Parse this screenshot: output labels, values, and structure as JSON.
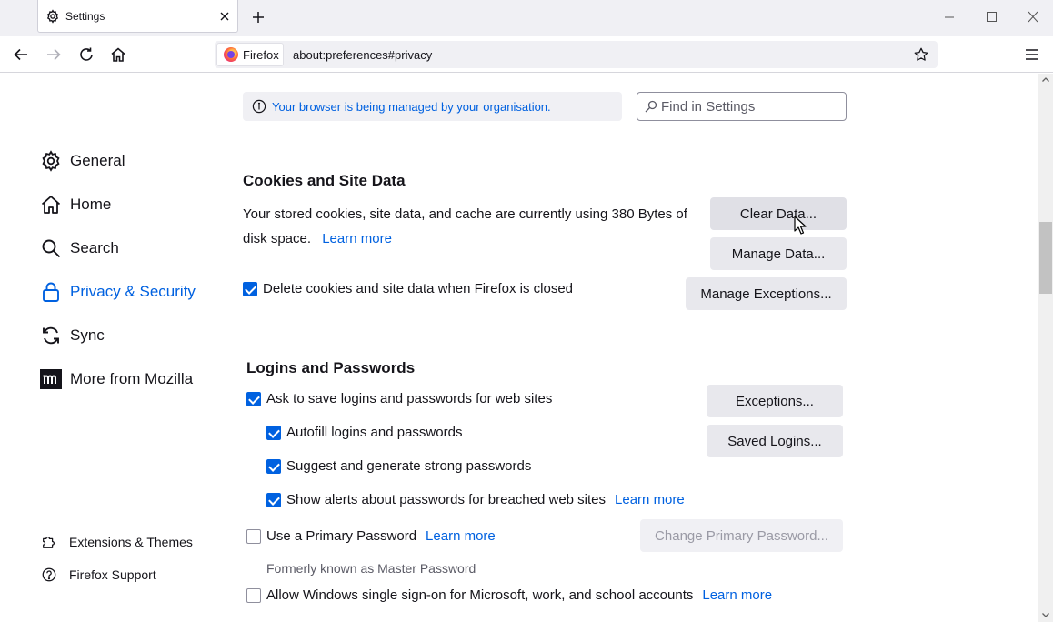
{
  "browser": {
    "tab_title": "Settings",
    "identity_label": "Firefox",
    "url": "about:preferences#privacy"
  },
  "sidebar": {
    "categories": [
      {
        "label": "General",
        "icon": "gear-icon"
      },
      {
        "label": "Home",
        "icon": "home-icon"
      },
      {
        "label": "Search",
        "icon": "search-icon"
      },
      {
        "label": "Privacy & Security",
        "icon": "lock-icon",
        "selected": true
      },
      {
        "label": "Sync",
        "icon": "sync-icon"
      },
      {
        "label": "More from Mozilla",
        "icon": "mozilla-icon"
      }
    ],
    "footer": [
      {
        "label": "Extensions & Themes",
        "icon": "puzzle-icon"
      },
      {
        "label": "Firefox Support",
        "icon": "help-icon"
      }
    ]
  },
  "policy_notice": "Your browser is being managed by your organisation.",
  "search_placeholder": "Find in Settings",
  "cookies": {
    "heading": "Cookies and Site Data",
    "description_line1": "Your stored cookies, site data, and cache are currently using 380 Bytes of",
    "description_line2": "disk space.",
    "learn_more": "Learn more",
    "clear_data_button": "Clear Data...",
    "manage_data_button": "Manage Data...",
    "manage_exceptions_button": "Manage Exceptions...",
    "delete_on_close": {
      "label": "Delete cookies and site data when Firefox is closed",
      "checked": true
    }
  },
  "logins": {
    "heading": "Logins and Passwords",
    "ask_to_save": {
      "label": "Ask to save logins and passwords for web sites",
      "checked": true
    },
    "autofill": {
      "label": "Autofill logins and passwords",
      "checked": true
    },
    "suggest": {
      "label": "Suggest and generate strong passwords",
      "checked": true
    },
    "breach_alerts": {
      "label": "Show alerts about passwords for breached web sites",
      "checked": true,
      "learn_more": "Learn more"
    },
    "exceptions_button": "Exceptions...",
    "saved_logins_button": "Saved Logins...",
    "primary_password": {
      "label": "Use a Primary Password",
      "checked": false,
      "learn_more": "Learn more"
    },
    "change_primary_button": "Change Primary Password...",
    "formerly_known": "Formerly known as Master Password",
    "windows_sso": {
      "label": "Allow Windows single sign-on for Microsoft, work, and school accounts",
      "checked": false,
      "learn_more": "Learn more"
    }
  },
  "colors": {
    "accent": "#0061e0",
    "button_bg": "#e8e8ed",
    "chrome_bg": "#f0f0f4"
  }
}
